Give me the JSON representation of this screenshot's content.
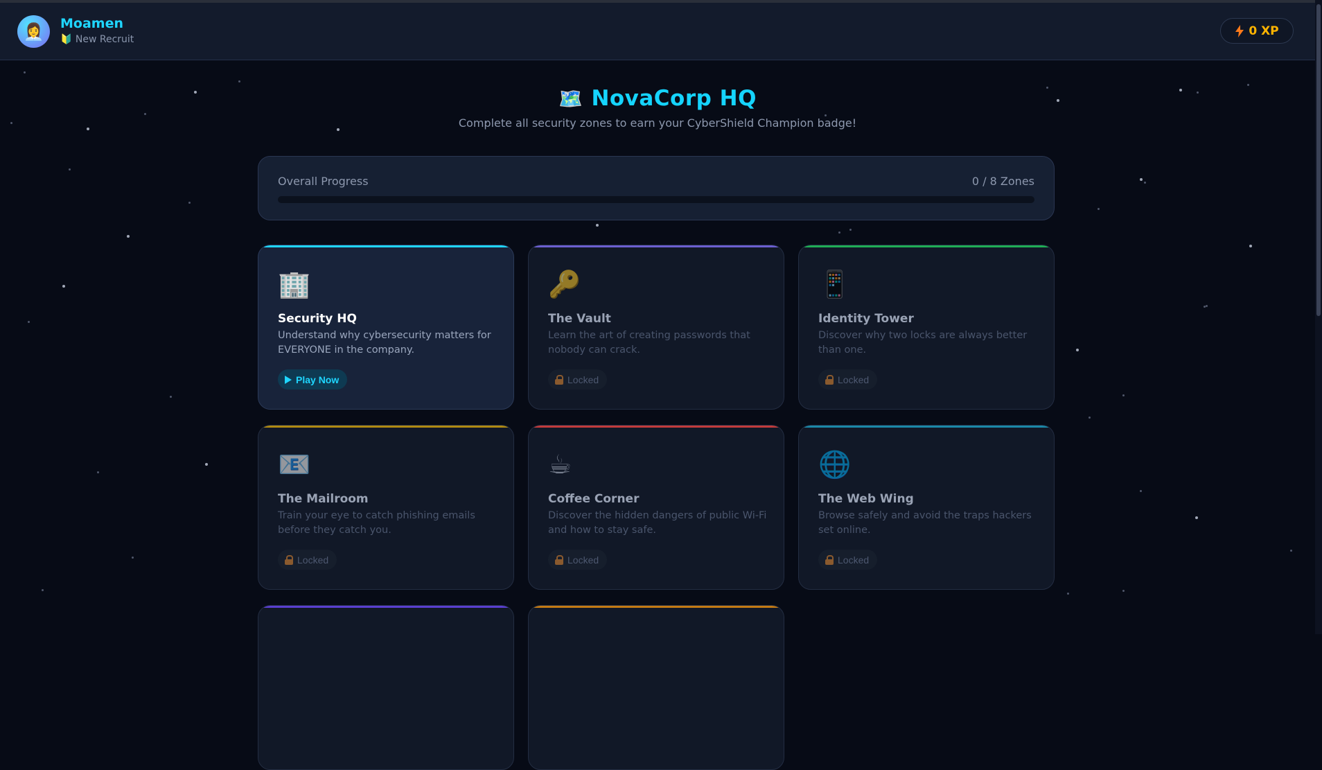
{
  "user": {
    "name": "Moamen",
    "rank_icon": "🔰",
    "rank": "New Recruit",
    "avatar_icon": "👩‍💼"
  },
  "xp": {
    "value": "0 XP",
    "icon": "lightning-icon",
    "color": "#ffb400"
  },
  "hero": {
    "icon": "🗺️",
    "title": "NovaCorp HQ",
    "subtitle": "Complete all security zones to earn your CyberShield Champion badge!"
  },
  "progress": {
    "label": "Overall Progress",
    "count": "0 / 8 Zones",
    "fraction": 0
  },
  "zones": [
    {
      "icon": "🏢",
      "title": "Security HQ",
      "desc": "Understand why cybersecurity matters for EVERYONE in the company.",
      "status": "Play Now",
      "accent": "#1fd6ff",
      "locked": false
    },
    {
      "icon": "🔑",
      "title": "The Vault",
      "desc": "Learn the art of creating passwords that nobody can crack.",
      "status": "Locked",
      "accent": "#6b5fd0",
      "locked": true
    },
    {
      "icon": "📱",
      "title": "Identity Tower",
      "desc": "Discover why two locks are always better than one.",
      "status": "Locked",
      "accent": "#1fae55",
      "locked": true
    },
    {
      "icon": "📧",
      "title": "The Mailroom",
      "desc": "Train your eye to catch phishing emails before they catch you.",
      "status": "Locked",
      "accent": "#b08a12",
      "locked": true
    },
    {
      "icon": "☕",
      "title": "Coffee Corner",
      "desc": "Discover the hidden dangers of public Wi-Fi and how to stay safe.",
      "status": "Locked",
      "accent": "#c23b3b",
      "locked": true
    },
    {
      "icon": "🌐",
      "title": "The Web Wing",
      "desc": "Browse safely and avoid the traps hackers set online.",
      "status": "Locked",
      "accent": "#1b88a8",
      "locked": true
    },
    {
      "icon": "",
      "title": "",
      "desc": "",
      "status": "",
      "accent": "#5a3fd0",
      "locked": true
    },
    {
      "icon": "",
      "title": "",
      "desc": "",
      "status": "",
      "accent": "#c47a14",
      "locked": true
    }
  ]
}
